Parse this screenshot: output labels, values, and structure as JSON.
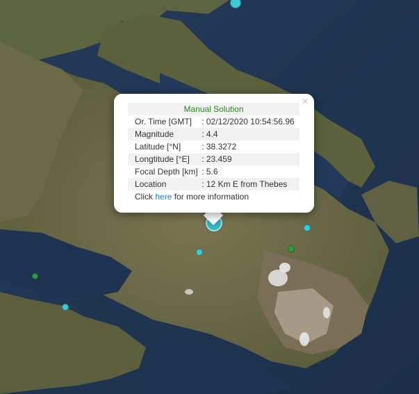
{
  "map": {
    "colors": {
      "sea": "#1f3550",
      "land": "#6b6a4a",
      "land_dark": "#4e5236",
      "urban": "#b9aea0"
    }
  },
  "markers": [
    {
      "name": "marker-top",
      "color": "cyan"
    },
    {
      "name": "marker-selected",
      "color": "cyan"
    },
    {
      "name": "marker-east",
      "color": "cyan"
    },
    {
      "name": "marker-south",
      "color": "cyan"
    },
    {
      "name": "marker-green-east",
      "color": "green"
    },
    {
      "name": "marker-green-west",
      "color": "green"
    },
    {
      "name": "marker-gulf",
      "color": "cyan"
    }
  ],
  "popup": {
    "close_symbol": "×",
    "title": "Manual Solution",
    "rows": [
      {
        "label": "Or. Time [GMT]",
        "value": ": 02/12/2020 10:54:56.96"
      },
      {
        "label": "Magnitude",
        "value": ": 4.4"
      },
      {
        "label": "Latitude [°N]",
        "value": ": 38.3272"
      },
      {
        "label": "Longtitude [°E]",
        "value": ": 23.459"
      },
      {
        "label": "Focal Depth [km]",
        "value": ": 5.6"
      },
      {
        "label": "Location",
        "value": ": 12 Km E from Thebes"
      }
    ],
    "footer_prefix": "Click ",
    "footer_link": "here",
    "footer_suffix": " for more information"
  }
}
